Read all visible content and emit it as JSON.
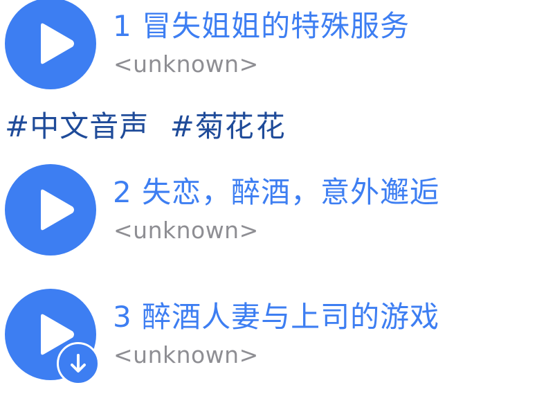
{
  "tracks": [
    {
      "title": "1 冒失姐姐的特殊服务",
      "artist": "<unknown>"
    },
    {
      "title": "2 失恋，醉酒，意外邂逅",
      "artist": "<unknown>"
    },
    {
      "title": "3 醉酒人妻与上司的游戏",
      "artist": "<unknown>"
    }
  ],
  "hashtags": {
    "tag1": "#中文音声",
    "tag2_highlighted": "#菊花",
    "tag2_rest": "花"
  },
  "icons": {
    "play": "play-icon",
    "download": "download-arrow-icon"
  },
  "colors": {
    "accent": "#3d7ef2",
    "hashtag_text": "#1f4b99",
    "highlight": "#fbe565",
    "artist_text": "#8e8e93"
  }
}
